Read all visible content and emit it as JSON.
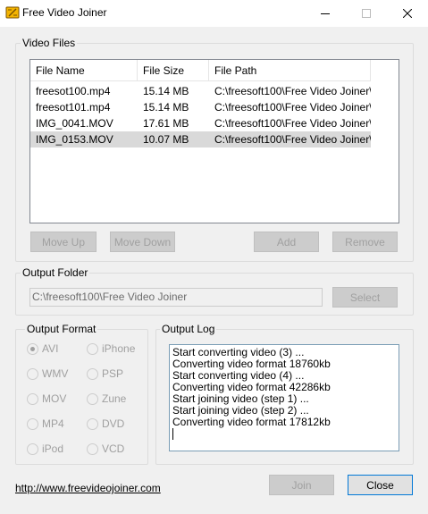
{
  "window": {
    "title": "Free Video Joiner",
    "controls": [
      "minimize",
      "maximize",
      "close"
    ]
  },
  "video_files": {
    "group_label": "Video Files",
    "columns": [
      "File Name",
      "File Size",
      "File Path"
    ],
    "rows": [
      [
        "freesot100.mp4",
        "15.14 MB",
        "C:\\freesoft100\\Free Video Joiner\\"
      ],
      [
        "freesot101.mp4",
        "15.14 MB",
        "C:\\freesoft100\\Free Video Joiner\\"
      ],
      [
        "IMG_0041.MOV",
        "17.61 MB",
        "C:\\freesoft100\\Free Video Joiner\\"
      ],
      [
        "IMG_0153.MOV",
        "10.07 MB",
        "C:\\freesoft100\\Free Video Joiner\\"
      ]
    ],
    "selected_row": 3,
    "buttons": {
      "move_up": "Move Up",
      "move_down": "Move Down",
      "add": "Add",
      "remove": "Remove"
    }
  },
  "output_folder": {
    "group_label": "Output Folder",
    "value": "C:\\freesoft100\\Free Video Joiner",
    "select_label": "Select"
  },
  "output_format": {
    "group_label": "Output Format",
    "options": [
      "AVI",
      "iPhone",
      "WMV",
      "PSP",
      "MOV",
      "Zune",
      "MP4",
      "DVD",
      "iPod",
      "VCD"
    ],
    "selected": "AVI"
  },
  "output_log": {
    "group_label": "Output Log",
    "lines": [
      "Start converting video (3) ...",
      "Converting video format 18760kb",
      "Start converting video (4) ...",
      "Converting video format 42286kb",
      "Start joining video (step 1) ...",
      "Start joining video (step 2) ...",
      "Converting video format 17812kb"
    ]
  },
  "footer": {
    "link": "http://www.freevideojoiner.com",
    "join_label": "Join",
    "close_label": "Close"
  },
  "colors": {
    "window_bg": "#f0f0f0",
    "selection_bg": "#d9d9d9",
    "default_button_border": "#0078d7",
    "log_border": "#7a9db5"
  }
}
